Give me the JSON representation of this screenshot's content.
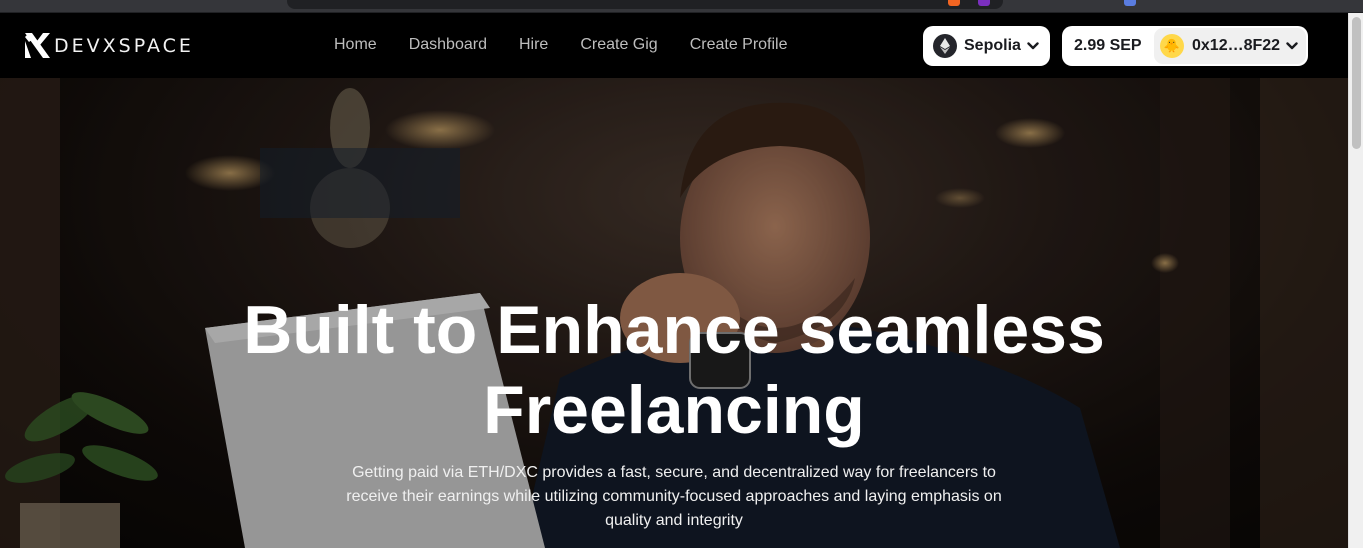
{
  "brand": {
    "name": "DEVXSPACE"
  },
  "nav": {
    "links": [
      "Home",
      "Dashboard",
      "Hire",
      "Create Gig",
      "Create Profile"
    ]
  },
  "wallet": {
    "network": "Sepolia",
    "balance": "2.99 SEP",
    "address": "0x12…8F22",
    "network_icon": "ethereum-icon",
    "avatar_icon": "chick-emoji"
  },
  "hero": {
    "title_line1": "Built to Enhance seamless",
    "title_line2": "Freelancing",
    "subtitle": "Getting paid via ETH/DXC provides a fast, secure, and decentralized way for freelancers to receive their earnings while utilizing community-focused approaches and laying emphasis on quality and integrity"
  },
  "colors": {
    "navbar_bg": "#000000",
    "button_bg": "#ffffff",
    "button_text": "#1a1b1f",
    "nav_link": "#bdbdbd"
  }
}
